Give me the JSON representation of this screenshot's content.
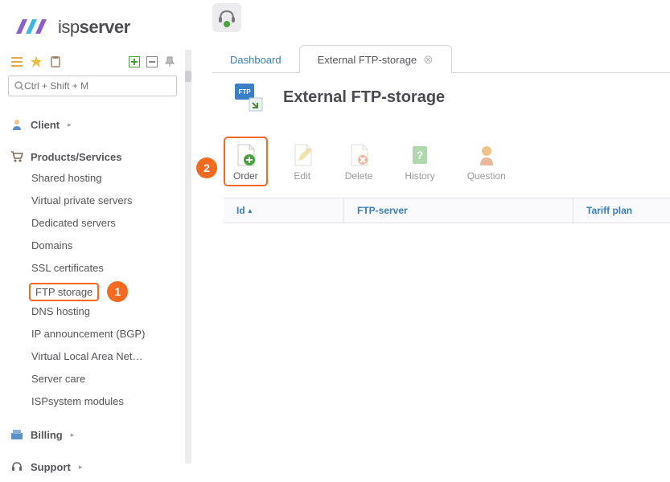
{
  "brand": {
    "name_light": "isp",
    "name_bold": "server"
  },
  "search": {
    "placeholder": "Ctrl + Shift + M"
  },
  "nav": {
    "client": {
      "label": "Client"
    },
    "products": {
      "label": "Products/Services",
      "items": [
        "Shared hosting",
        "Virtual private servers",
        "Dedicated servers",
        "Domains",
        "SSL certificates",
        "FTP storage",
        "DNS hosting",
        "IP announcement (BGP)",
        "Virtual Local Area Net…",
        "Server care",
        "ISPsystem modules"
      ],
      "active_index": 5
    },
    "billing": {
      "label": "Billing"
    },
    "support": {
      "label": "Support"
    }
  },
  "tabs": {
    "dashboard": "Dashboard",
    "active": "External FTP-storage"
  },
  "page_title": "External FTP-storage",
  "actions": {
    "order": "Order",
    "edit": "Edit",
    "delete": "Delete",
    "history": "History",
    "question": "Question"
  },
  "columns": {
    "id": "Id",
    "server": "FTP-server",
    "tariff": "Tariff plan"
  },
  "annotations": {
    "step1": "1",
    "step2": "2"
  }
}
